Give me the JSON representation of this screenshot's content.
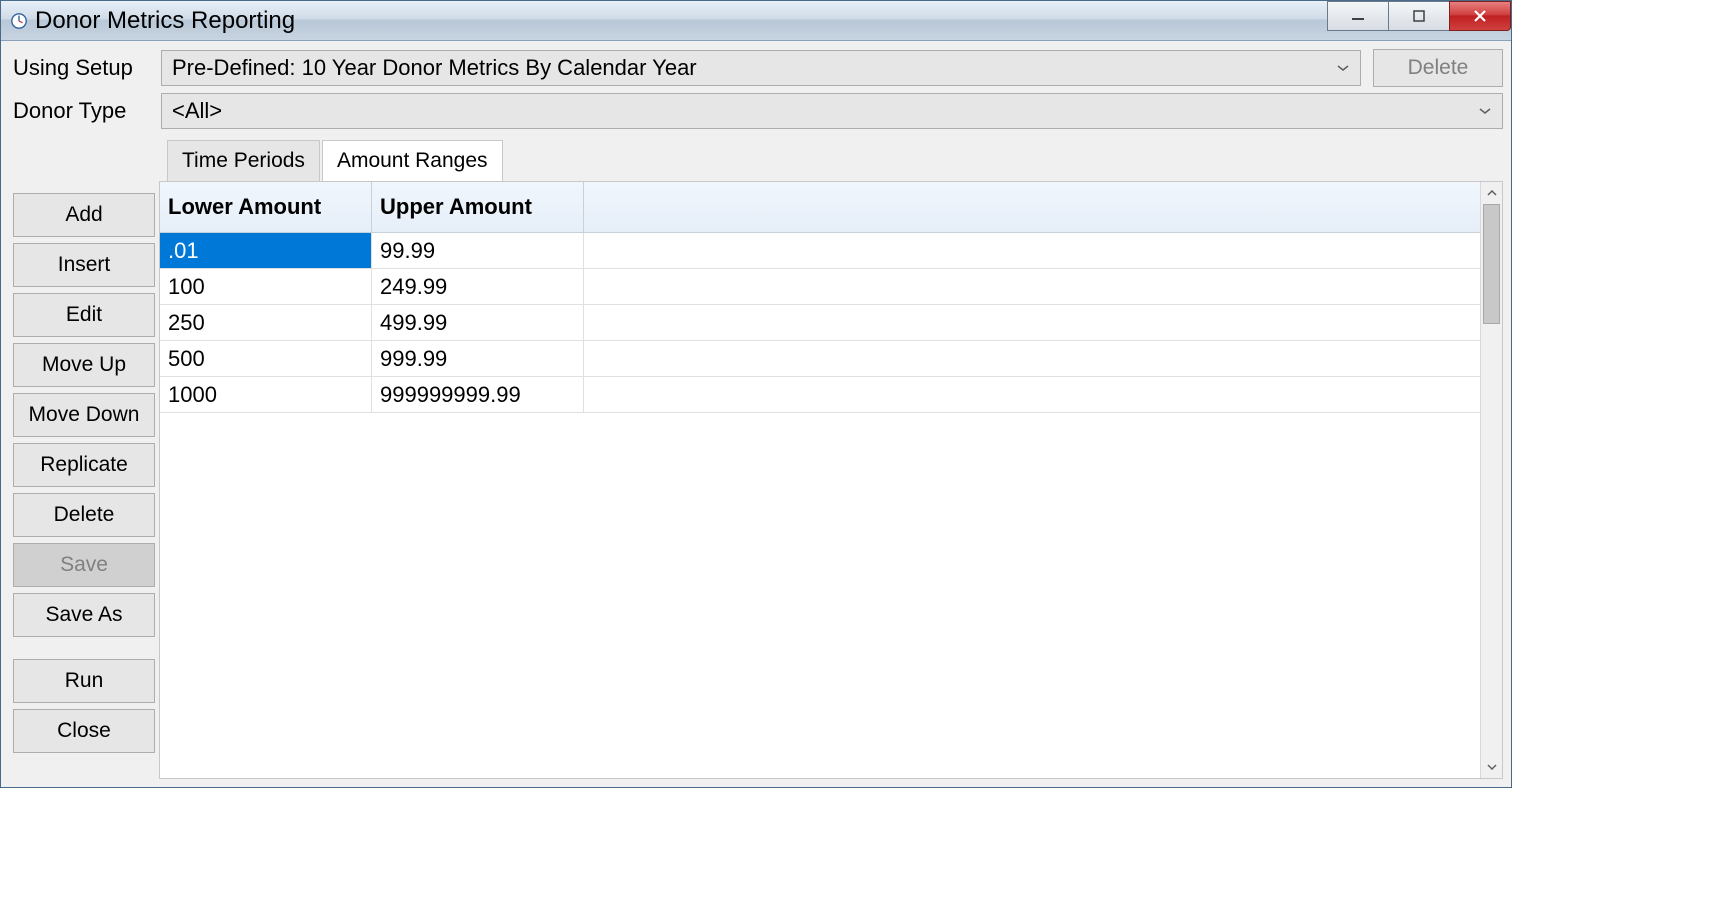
{
  "window": {
    "title": "Donor Metrics Reporting"
  },
  "form": {
    "using_setup_label": "Using Setup",
    "using_setup_value": "Pre-Defined: 10 Year Donor Metrics By Calendar Year",
    "donor_type_label": "Donor Type",
    "donor_type_value": "<All>",
    "delete_setup_label": "Delete"
  },
  "tabs": {
    "time_periods": "Time Periods",
    "amount_ranges": "Amount Ranges"
  },
  "side": {
    "add": "Add",
    "insert": "Insert",
    "edit": "Edit",
    "move_up": "Move Up",
    "move_down": "Move Down",
    "replicate": "Replicate",
    "delete": "Delete",
    "save": "Save",
    "save_as": "Save As",
    "run": "Run",
    "close": "Close"
  },
  "grid": {
    "col_lower": "Lower Amount",
    "col_upper": "Upper Amount",
    "rows": [
      {
        "lower": ".01",
        "upper": "99.99"
      },
      {
        "lower": "100",
        "upper": "249.99"
      },
      {
        "lower": "250",
        "upper": "499.99"
      },
      {
        "lower": "500",
        "upper": "999.99"
      },
      {
        "lower": "1000",
        "upper": "999999999.99"
      }
    ],
    "selected_row": 0,
    "selected_col": "lower"
  }
}
